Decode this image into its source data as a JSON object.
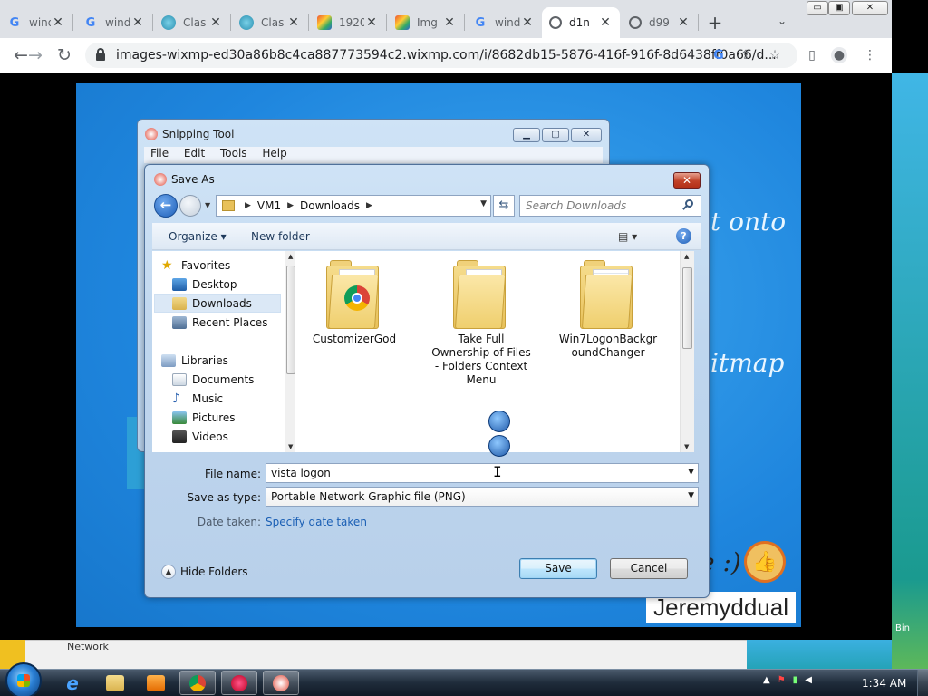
{
  "browser": {
    "tabs": [
      {
        "title": "wind",
        "favicon": "google-icon",
        "active": false
      },
      {
        "title": "wind",
        "favicon": "google-icon",
        "active": false
      },
      {
        "title": "Clas",
        "favicon": "globe-icon",
        "active": false
      },
      {
        "title": "Clas",
        "favicon": "globe-icon",
        "active": false
      },
      {
        "title": "1920",
        "favicon": "image-icon",
        "active": false
      },
      {
        "title": "Img",
        "favicon": "image-icon",
        "active": false
      },
      {
        "title": "wind",
        "favicon": "google-icon",
        "active": false
      },
      {
        "title": "d1n",
        "favicon": "globe-icon",
        "active": true
      },
      {
        "title": "d99",
        "favicon": "globe-icon",
        "active": false
      }
    ],
    "url": "images-wixmp-ed30a86b8c4ca887773594c2.wixmp.com/i/8682db15-5876-416f-916f-8d6438ff0a66/d...",
    "close_glyph": "✕",
    "new_tab_glyph": "+",
    "tab_list_glyph": "⌄",
    "back_glyph": "←",
    "forward_glyph": "→",
    "reload_glyph": "↻",
    "win_min": "▭",
    "win_max": "▣",
    "win_close": "✕"
  },
  "slide": {
    "text1": "t onto",
    "text2": "itmap",
    "smile": "e :)",
    "signature": "Jeremyddual"
  },
  "snipping_tool": {
    "title": "Snipping Tool",
    "menu": [
      "File",
      "Edit",
      "Tools",
      "Help"
    ]
  },
  "save_as": {
    "title": "Save As",
    "breadcrumb": [
      "VM1",
      "Downloads"
    ],
    "search_placeholder": "Search Downloads",
    "organize_label": "Organize ▾",
    "new_folder_label": "New folder",
    "nav": {
      "favorites_header": "Favorites",
      "favorites": [
        "Desktop",
        "Downloads",
        "Recent Places"
      ],
      "libraries_header": "Libraries",
      "libraries": [
        "Documents",
        "Music",
        "Pictures",
        "Videos"
      ]
    },
    "files": [
      {
        "name": "CustomizerGod"
      },
      {
        "name": "Take Full Ownership of Files - Folders Context Menu"
      },
      {
        "name": "Win7LogonBackgroundChanger"
      }
    ],
    "file_name_label": "File name:",
    "file_name_value": "vista logon",
    "save_type_label": "Save as type:",
    "save_type_value": "Portable Network Graphic file (PNG)",
    "date_taken_label": "Date taken:",
    "date_taken_link": "Specify date taken",
    "hide_folders_label": "Hide Folders",
    "save_button": "Save",
    "cancel_button": "Cancel"
  },
  "page_bottom": {
    "network_label": "Network"
  },
  "desktop": {
    "bin_label": "Bin"
  },
  "taskbar": {
    "clock": "1:34 AM"
  },
  "colors": {
    "slide_bg": "#1f86de",
    "dialog_frame": "#bfd6ee",
    "link": "#1a5fb4",
    "taskbar": "#1f2c3b"
  }
}
